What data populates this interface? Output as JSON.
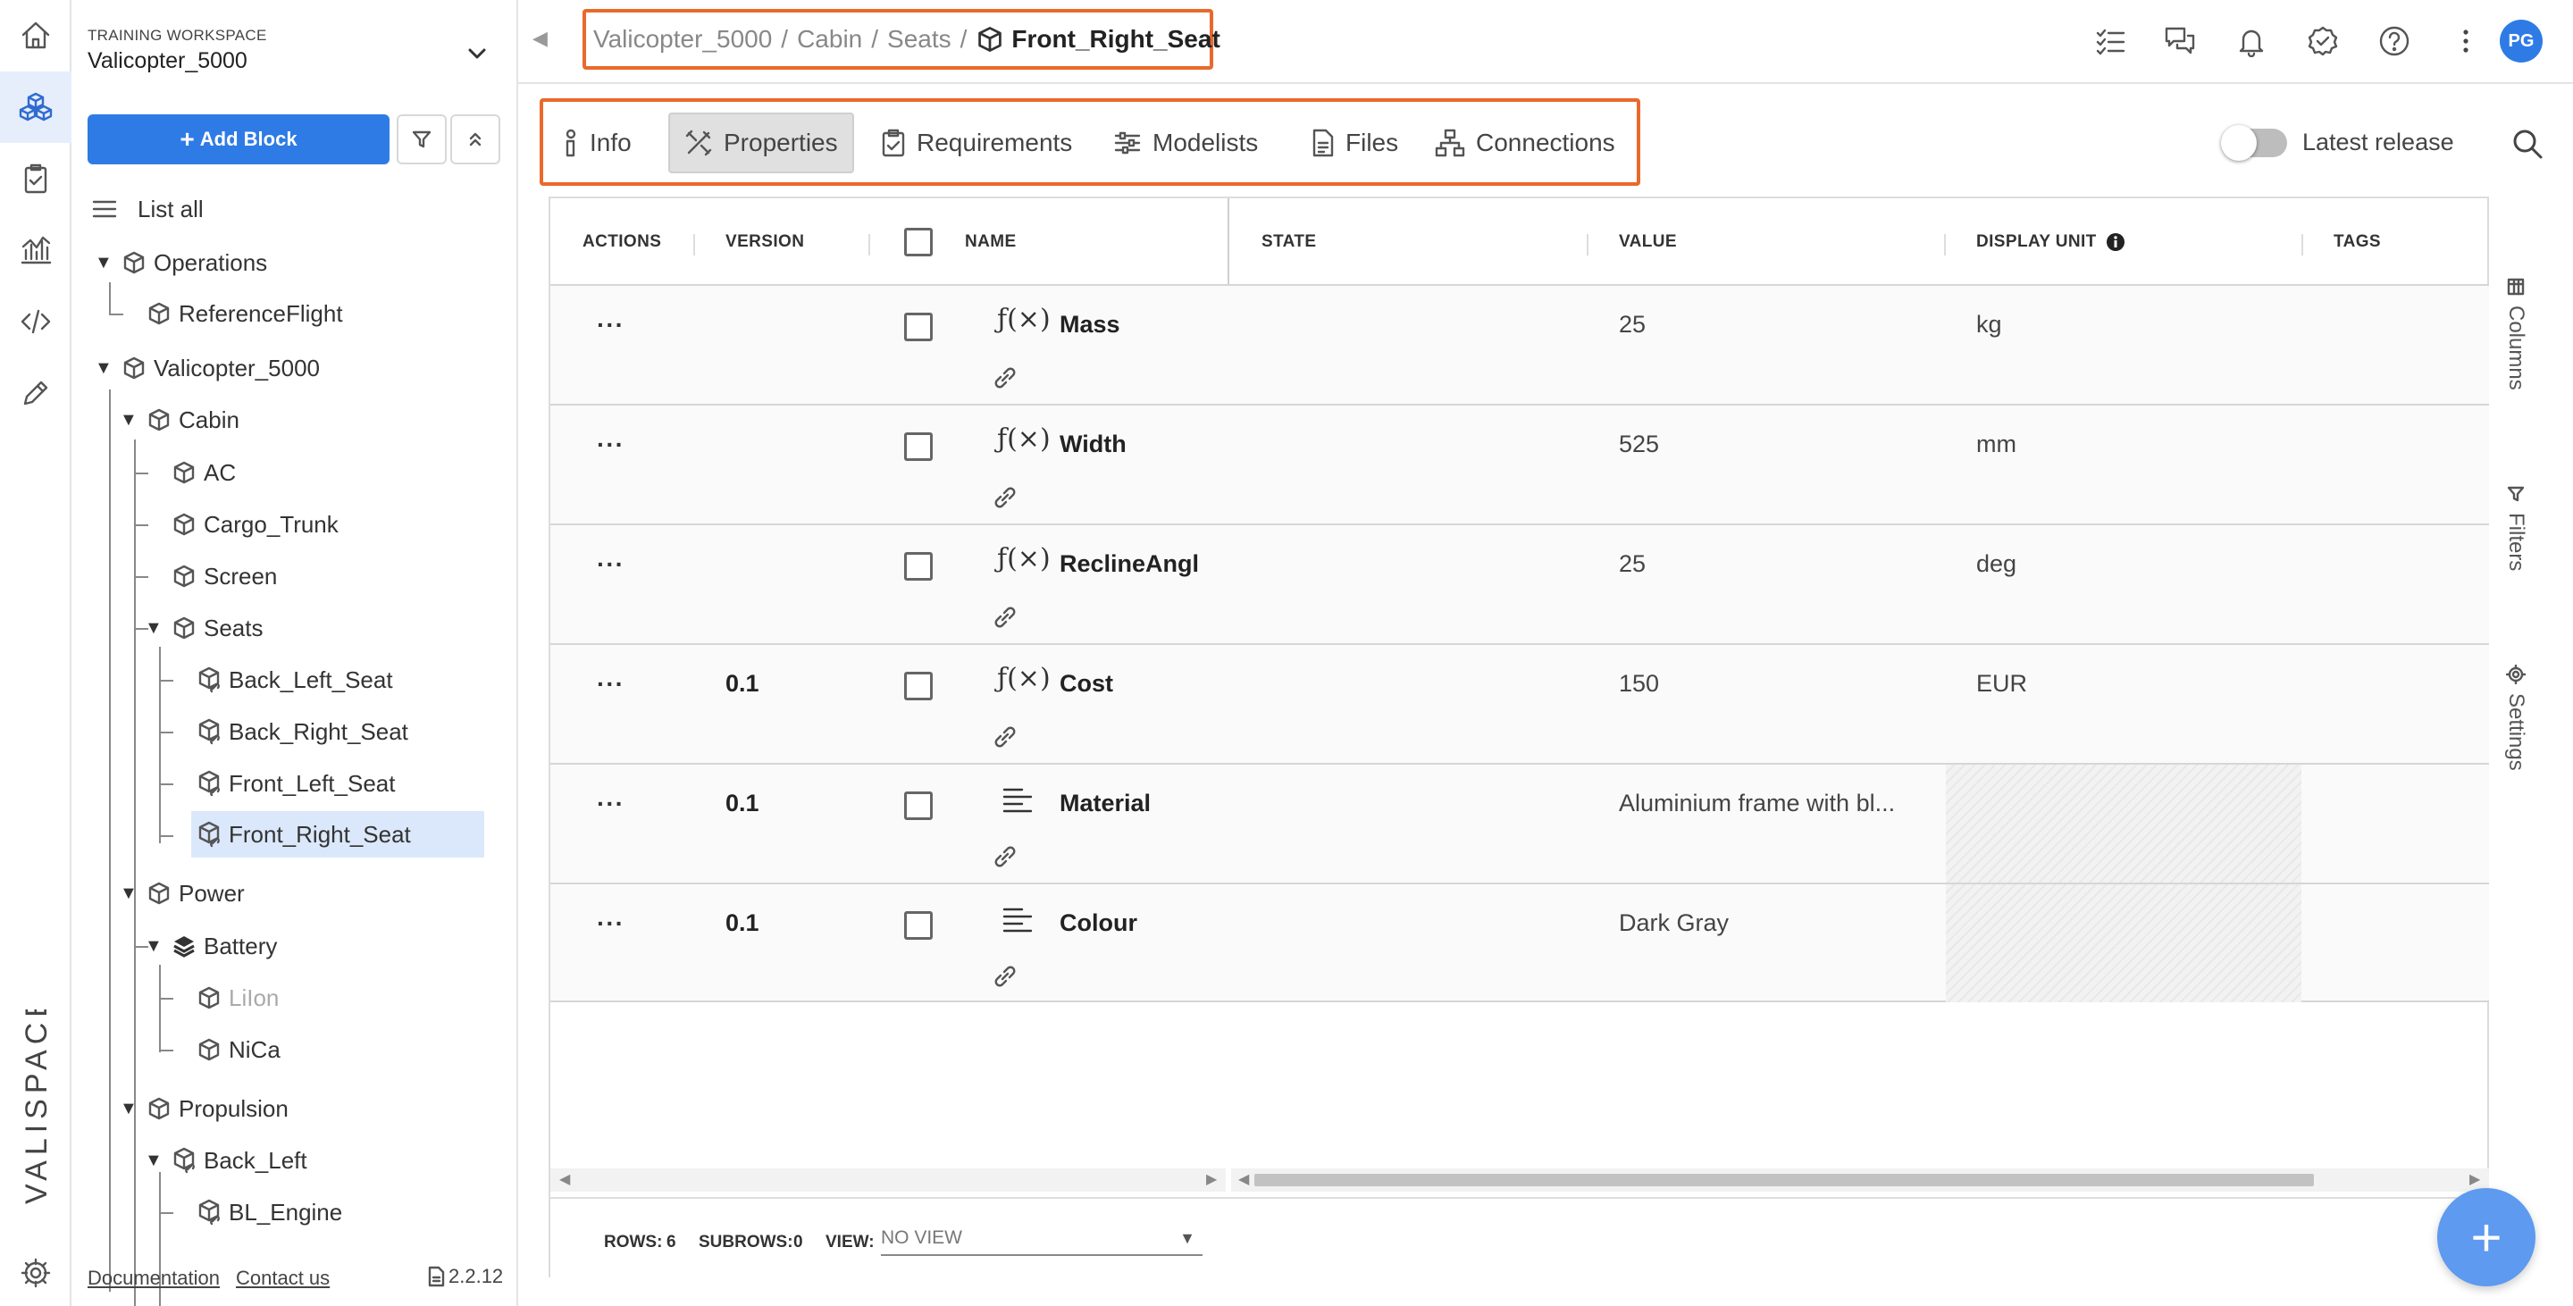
{
  "workspace": {
    "label": "TRAINING WORKSPACE",
    "name": "Valicopter_5000"
  },
  "sidebar": {
    "add_block_label": "Add Block",
    "list_all_label": "List all",
    "tree": [
      {
        "label": "Operations"
      },
      {
        "label": "ReferenceFlight"
      },
      {
        "label": "Valicopter_5000"
      },
      {
        "label": "Cabin"
      },
      {
        "label": "AC"
      },
      {
        "label": "Cargo_Trunk"
      },
      {
        "label": "Screen"
      },
      {
        "label": "Seats"
      },
      {
        "label": "Back_Left_Seat"
      },
      {
        "label": "Back_Right_Seat"
      },
      {
        "label": "Front_Left_Seat"
      },
      {
        "label": "Front_Right_Seat"
      },
      {
        "label": "Power"
      },
      {
        "label": "Battery"
      },
      {
        "label": "LiIon"
      },
      {
        "label": "NiCa"
      },
      {
        "label": "Propulsion"
      },
      {
        "label": "Back_Left"
      },
      {
        "label": "BL_Engine"
      }
    ],
    "footer": {
      "documentation": "Documentation",
      "contact": "Contact us",
      "version": "2.2.12"
    }
  },
  "breadcrumb": {
    "items": [
      "Valicopter_5000",
      "Cabin",
      "Seats"
    ],
    "separator": "/",
    "current": "Front_Right_Seat"
  },
  "header": {
    "avatar_initials": "PG"
  },
  "tabs": [
    {
      "label": "Info"
    },
    {
      "label": "Properties"
    },
    {
      "label": "Requirements"
    },
    {
      "label": "Modelists"
    },
    {
      "label": "Files"
    },
    {
      "label": "Connections"
    }
  ],
  "latest_release_label": "Latest release",
  "table": {
    "columns": [
      "ACTIONS",
      "VERSION",
      "NAME",
      "STATE",
      "VALUE",
      "DISPLAY UNIT",
      "TAGS"
    ],
    "rows": [
      {
        "actions": "···",
        "version": "",
        "name": "Mass",
        "state": "",
        "value": "25",
        "unit": "kg"
      },
      {
        "actions": "···",
        "version": "",
        "name": "Width",
        "state": "",
        "value": "525",
        "unit": "mm"
      },
      {
        "actions": "···",
        "version": "",
        "name": "ReclineAngl",
        "state": "",
        "value": "25",
        "unit": "deg"
      },
      {
        "actions": "···",
        "version": "0.1",
        "name": "Cost",
        "state": "",
        "value": "150",
        "unit": "EUR"
      },
      {
        "actions": "···",
        "version": "0.1",
        "name": "Material",
        "state": "",
        "value": "Aluminium frame with bl...",
        "unit": ""
      },
      {
        "actions": "···",
        "version": "0.1",
        "name": "Colour",
        "state": "",
        "value": "Dark Gray",
        "unit": ""
      }
    ],
    "fx_symbol": "ƒ(×)",
    "footer": {
      "rows_label": "ROWS:",
      "rows": "6",
      "subrows_label": "SUBROWS:",
      "subrows": "0",
      "view_label": "VIEW:",
      "view_value": "NO VIEW"
    }
  },
  "side_tabs": {
    "columns": "Columns",
    "filters": "Filters",
    "settings": "Settings"
  },
  "fab_label": "+"
}
